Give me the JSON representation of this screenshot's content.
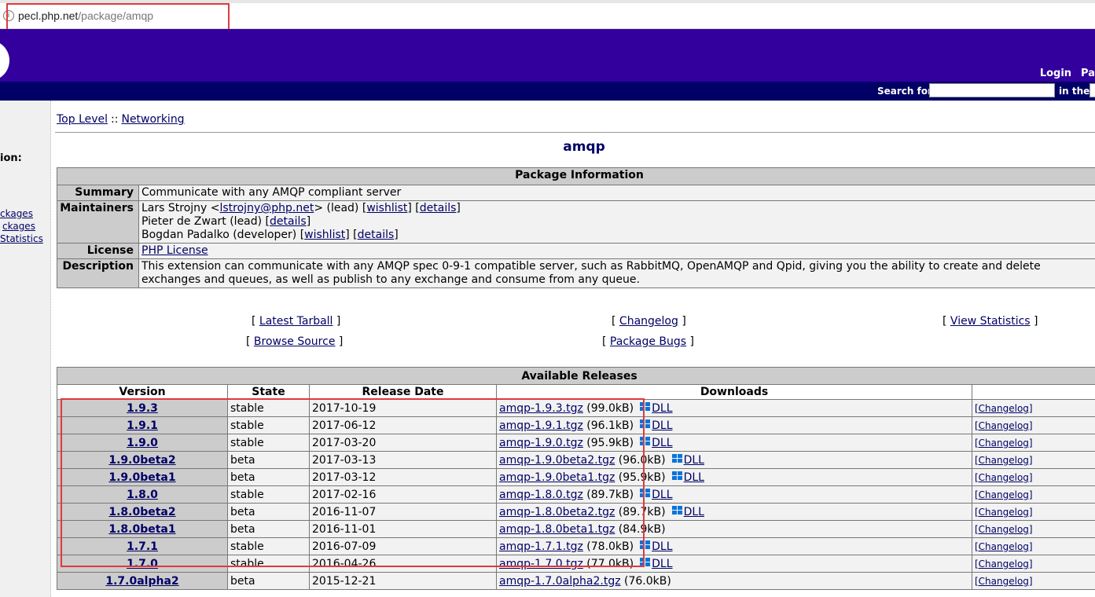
{
  "browser": {
    "url_host": "pecl.php.net",
    "url_path": "/package/amqp"
  },
  "header": {
    "login": "Login",
    "other": "Pa"
  },
  "searchbar": {
    "label": "Search for",
    "in_label": "in the"
  },
  "sidebar": {
    "heading": "ion:",
    "links": [
      "ckages",
      "ckages",
      "Statistics"
    ]
  },
  "breadcrumb": {
    "top": "Top Level",
    "sep": "::",
    "cat": "Networking"
  },
  "package": {
    "name": "amqp",
    "info_heading": "Package Information",
    "summary_label": "Summary",
    "summary": "Communicate with any AMQP compliant server",
    "maintainers_label": "Maintainers",
    "maintainers": [
      {
        "prefix": "Lars Strojny <",
        "email": "lstrojny@php.net",
        "suffix": "> (lead) [",
        "wishlist": "wishlist",
        "mid": "] [",
        "details": "details",
        "end": "]"
      },
      {
        "prefix": "Pieter de Zwart (lead) [",
        "details": "details",
        "end": "]"
      },
      {
        "prefix": "Bogdan Padalko (developer) [",
        "wishlist": "wishlist",
        "mid": "] [",
        "details": "details",
        "end": "]"
      }
    ],
    "license_label": "License",
    "license": "PHP License",
    "description_label": "Description",
    "description": "This extension can communicate with any AMQP spec 0-9-1 compatible server, such as RabbitMQ, OpenAMQP and Qpid, giving you the ability to create and delete exchanges and queues, as well as publish to any exchange and consume from any queue."
  },
  "links": {
    "latest_tarball": "Latest Tarball",
    "changelog": "Changelog",
    "view_statistics": "View Statistics",
    "browse_source": "Browse Source",
    "package_bugs": "Package Bugs",
    "open": "[",
    "close": "]"
  },
  "releases": {
    "heading": "Available Releases",
    "columns": [
      "Version",
      "State",
      "Release Date",
      "Downloads"
    ],
    "dll_label": "DLL",
    "changelog_label": "[Changelog]",
    "rows": [
      {
        "version": "1.9.3",
        "state": "stable",
        "date": "2017-10-19",
        "file": "amqp-1.9.3.tgz",
        "size": "(99.0kB)",
        "dll": true
      },
      {
        "version": "1.9.1",
        "state": "stable",
        "date": "2017-06-12",
        "file": "amqp-1.9.1.tgz",
        "size": "(96.1kB)",
        "dll": true
      },
      {
        "version": "1.9.0",
        "state": "stable",
        "date": "2017-03-20",
        "file": "amqp-1.9.0.tgz",
        "size": "(95.9kB)",
        "dll": true
      },
      {
        "version": "1.9.0beta2",
        "state": "beta",
        "date": "2017-03-13",
        "file": "amqp-1.9.0beta2.tgz",
        "size": "(96.0kB)",
        "dll": true
      },
      {
        "version": "1.9.0beta1",
        "state": "beta",
        "date": "2017-03-12",
        "file": "amqp-1.9.0beta1.tgz",
        "size": "(95.9kB)",
        "dll": true
      },
      {
        "version": "1.8.0",
        "state": "stable",
        "date": "2017-02-16",
        "file": "amqp-1.8.0.tgz",
        "size": "(89.7kB)",
        "dll": true
      },
      {
        "version": "1.8.0beta2",
        "state": "beta",
        "date": "2016-11-07",
        "file": "amqp-1.8.0beta2.tgz",
        "size": "(89.7kB)",
        "dll": true
      },
      {
        "version": "1.8.0beta1",
        "state": "beta",
        "date": "2016-11-01",
        "file": "amqp-1.8.0beta1.tgz",
        "size": "(84.9kB)",
        "dll": false
      },
      {
        "version": "1.7.1",
        "state": "stable",
        "date": "2016-07-09",
        "file": "amqp-1.7.1.tgz",
        "size": "(78.0kB)",
        "dll": true
      },
      {
        "version": "1.7.0",
        "state": "stable",
        "date": "2016-04-26",
        "file": "amqp-1.7.0.tgz",
        "size": "(77.0kB)",
        "dll": true
      },
      {
        "version": "1.7.0alpha2",
        "state": "beta",
        "date": "2015-12-21",
        "file": "amqp-1.7.0alpha2.tgz",
        "size": "(76.0kB)",
        "dll": false
      }
    ]
  },
  "colors": {
    "header_purple": "#33009e",
    "navy": "#000066",
    "highlight_red": "#e0393e",
    "windows_blue": "#0a74d9"
  }
}
